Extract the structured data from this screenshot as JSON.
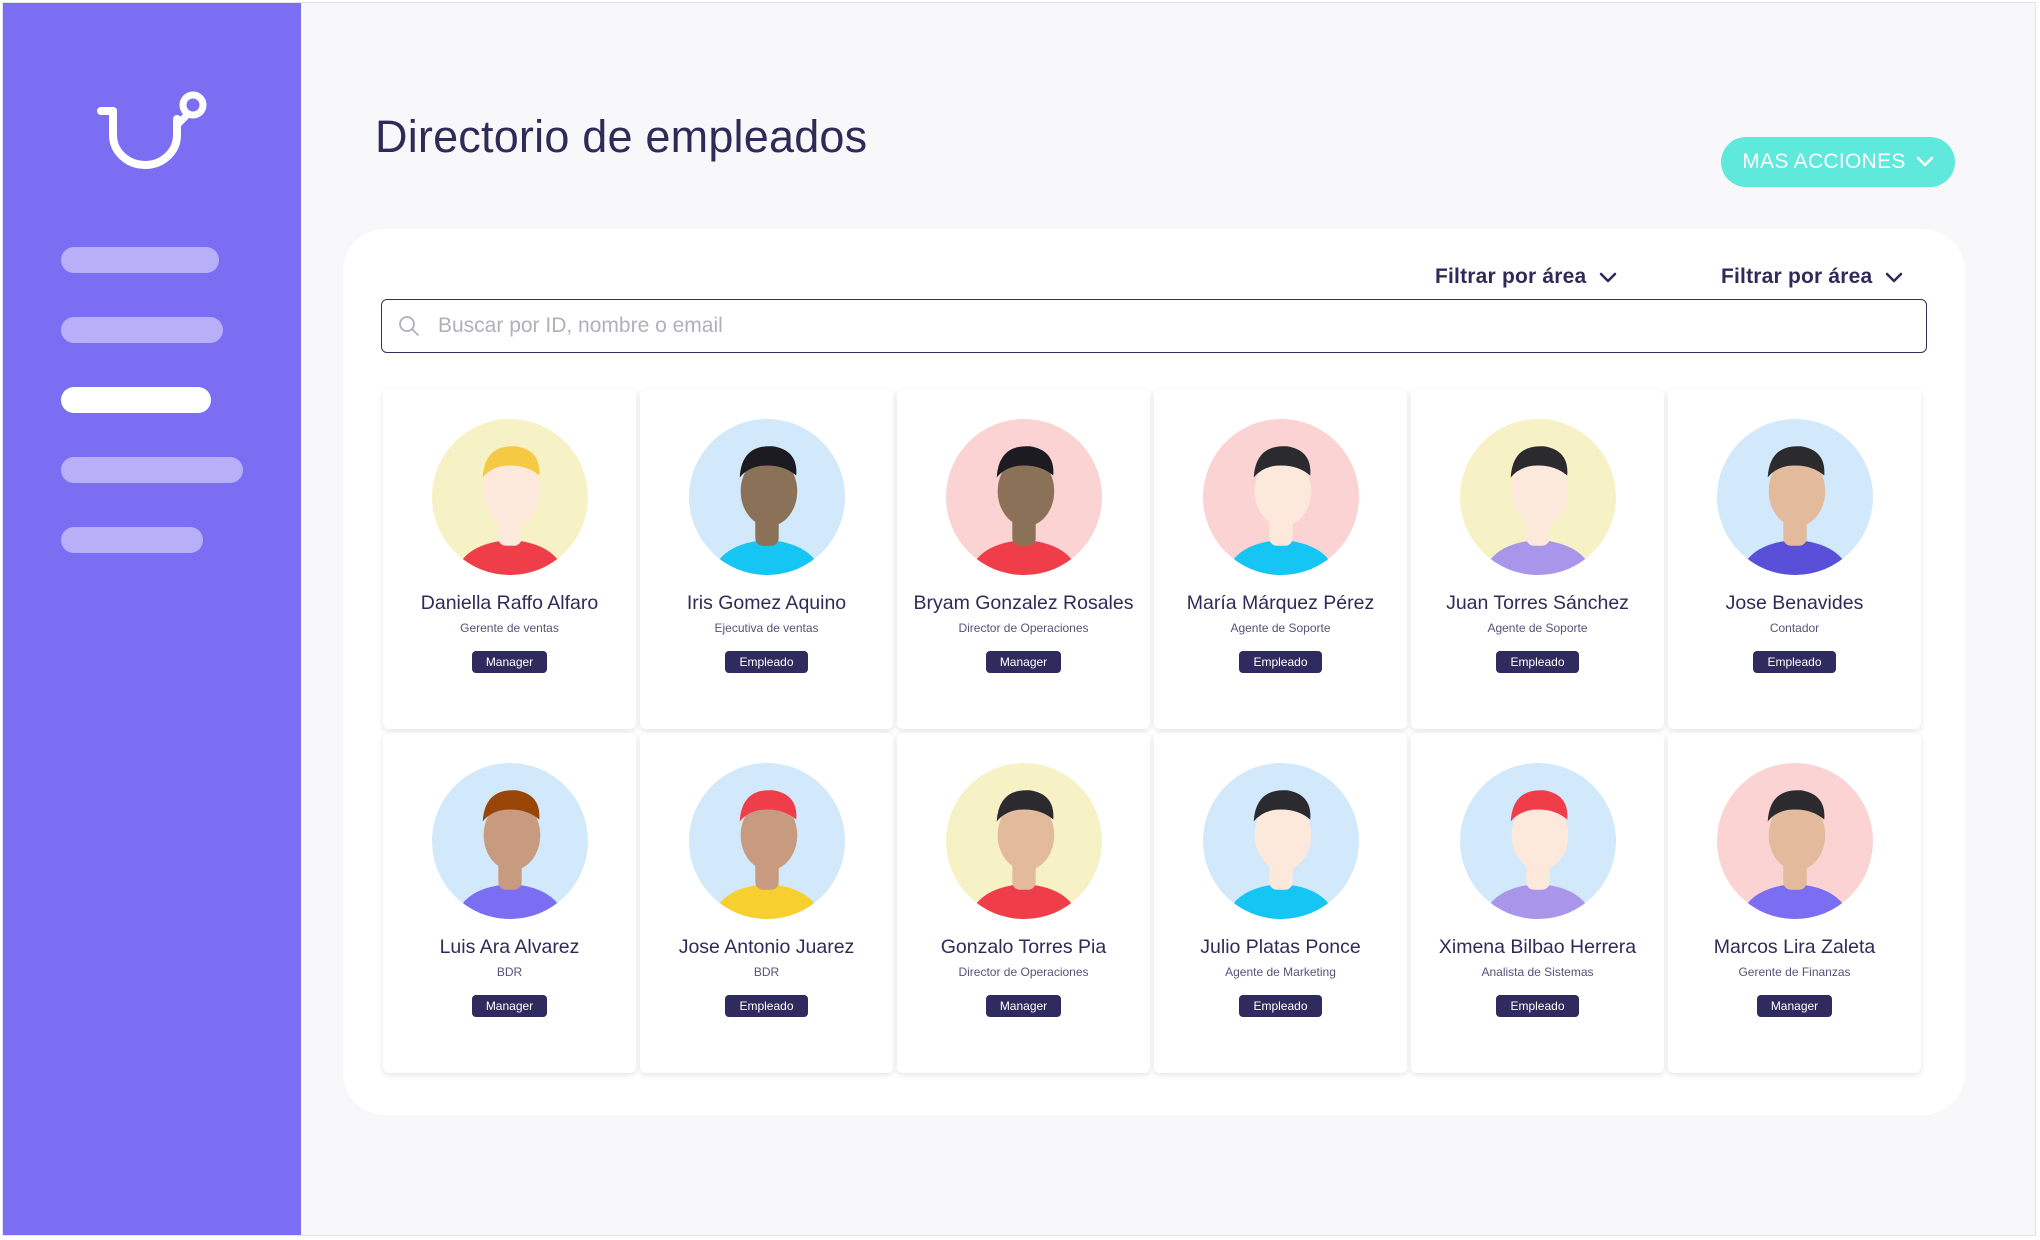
{
  "header": {
    "title": "Directorio de empleados",
    "more_actions": "MAS ACCIONES"
  },
  "filters": [
    {
      "label": "Filtrar por área"
    },
    {
      "label": "Filtrar por área"
    }
  ],
  "search": {
    "placeholder": "Buscar por ID, nombre o email",
    "value": ""
  },
  "colors": {
    "sidebar": "#7b6ef2",
    "nav_inactive": "#b7b0f8",
    "accent_button": "#5fe8dc",
    "badge": "#302b5e",
    "title_text": "#2f2b58"
  },
  "employees": [
    {
      "name": "Daniella Raffo Alfaro",
      "role": "Gerente de ventas",
      "badge": "Manager",
      "avatar_bg": "#f7f2c6",
      "skin": "#fde8dc",
      "hair": "#f6c945",
      "shirt": "#ef3e4a"
    },
    {
      "name": "Iris Gomez Aquino",
      "role": "Ejecutiva de ventas",
      "badge": "Empleado",
      "avatar_bg": "#d2e9fb",
      "skin": "#8a7158",
      "hair": "#1c1b22",
      "shirt": "#15c6f4"
    },
    {
      "name": "Bryam Gonzalez Rosales",
      "role": "Director de Operaciones",
      "badge": "Manager",
      "avatar_bg": "#fbd3d2",
      "skin": "#8a7158",
      "hair": "#1c1b22",
      "shirt": "#ef3e4a"
    },
    {
      "name": "María Márquez Pérez",
      "role": "Agente de Soporte",
      "badge": "Empleado",
      "avatar_bg": "#fbd3d2",
      "skin": "#fde8dc",
      "hair": "#2b2b2f",
      "shirt": "#15c6f4"
    },
    {
      "name": "Juan Torres Sánchez",
      "role": "Agente de Soporte",
      "badge": "Empleado",
      "avatar_bg": "#f7f2c6",
      "skin": "#fde8dc",
      "hair": "#2b2b2f",
      "shirt": "#a995ea"
    },
    {
      "name": "Jose Benavides",
      "role": "Contador",
      "badge": "Empleado",
      "avatar_bg": "#d2e9fb",
      "skin": "#e3bb9c",
      "hair": "#2b2b2f",
      "shirt": "#5a4fd8"
    },
    {
      "name": "Luis Ara Alvarez",
      "role": "BDR",
      "badge": "Manager",
      "avatar_bg": "#d2e9fb",
      "skin": "#c89a80",
      "hair": "#9a4508",
      "shirt": "#7b6ef2"
    },
    {
      "name": "Jose Antonio Juarez",
      "role": "BDR",
      "badge": "Empleado",
      "avatar_bg": "#d2e9fb",
      "skin": "#c89a80",
      "hair": "#ef3e4a",
      "shirt": "#f7cf2e"
    },
    {
      "name": "Gonzalo Torres Pia",
      "role": "Director de Operaciones",
      "badge": "Manager",
      "avatar_bg": "#f7f2c6",
      "skin": "#e3bb9c",
      "hair": "#2b2b2f",
      "shirt": "#ef3e4a"
    },
    {
      "name": "Julio Platas Ponce",
      "role": "Agente de Marketing",
      "badge": "Empleado",
      "avatar_bg": "#d2e9fb",
      "skin": "#fde8dc",
      "hair": "#2b2b2f",
      "shirt": "#15c6f4"
    },
    {
      "name": "Ximena Bilbao Herrera",
      "role": "Analista de Sistemas",
      "badge": "Empleado",
      "avatar_bg": "#d2e9fb",
      "skin": "#fde8dc",
      "hair": "#ef3e4a",
      "shirt": "#a995ea"
    },
    {
      "name": "Marcos Lira Zaleta",
      "role": "Gerente de Finanzas",
      "badge": "Manager",
      "avatar_bg": "#fbd3d2",
      "skin": "#e3bb9c",
      "hair": "#2b2b2f",
      "shirt": "#7b6ef2"
    }
  ]
}
